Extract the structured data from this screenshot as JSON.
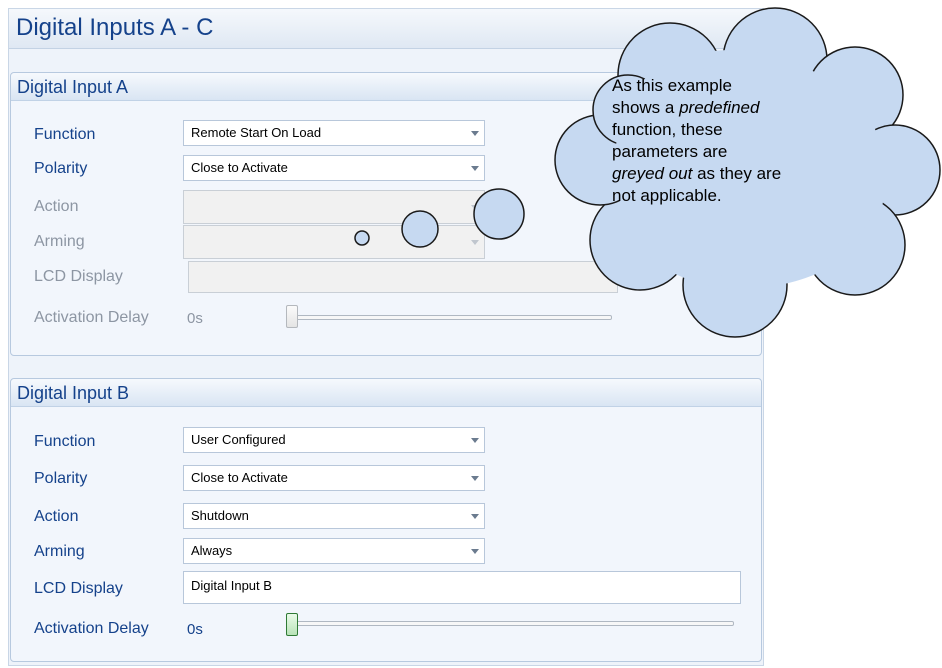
{
  "page": {
    "title": "Digital Inputs A - C"
  },
  "labels": {
    "function": "Function",
    "polarity": "Polarity",
    "action": "Action",
    "arming": "Arming",
    "lcd_display": "LCD Display",
    "activation_delay": "Activation Delay"
  },
  "input_a": {
    "title": "Digital Input A",
    "function_value": "Remote Start On Load",
    "polarity_value": "Close to Activate",
    "action_value": "",
    "arming_value": "",
    "lcd_display_value": "",
    "activation_delay_value": "0s",
    "activation_delay_fraction": 0
  },
  "input_b": {
    "title": "Digital Input B",
    "function_value": "User Configured",
    "polarity_value": "Close to Activate",
    "action_value": "Shutdown",
    "arming_value": "Always",
    "lcd_display_value": "Digital Input B",
    "activation_delay_value": "0s",
    "activation_delay_fraction": 0
  },
  "callout": {
    "line1": "As this example",
    "line2_prefix": "shows a ",
    "line2_emphasis": "predefined",
    "line3": "function, these",
    "line4": "parameters are",
    "line5_emphasis": "greyed out",
    "line5_suffix": " as they are",
    "line6": "not applicable."
  },
  "colors": {
    "heading": "#15428b",
    "disabled_text": "#8d96a3",
    "cloud_fill": "#c6d9f1",
    "panel_background": "#f2f6fc"
  }
}
